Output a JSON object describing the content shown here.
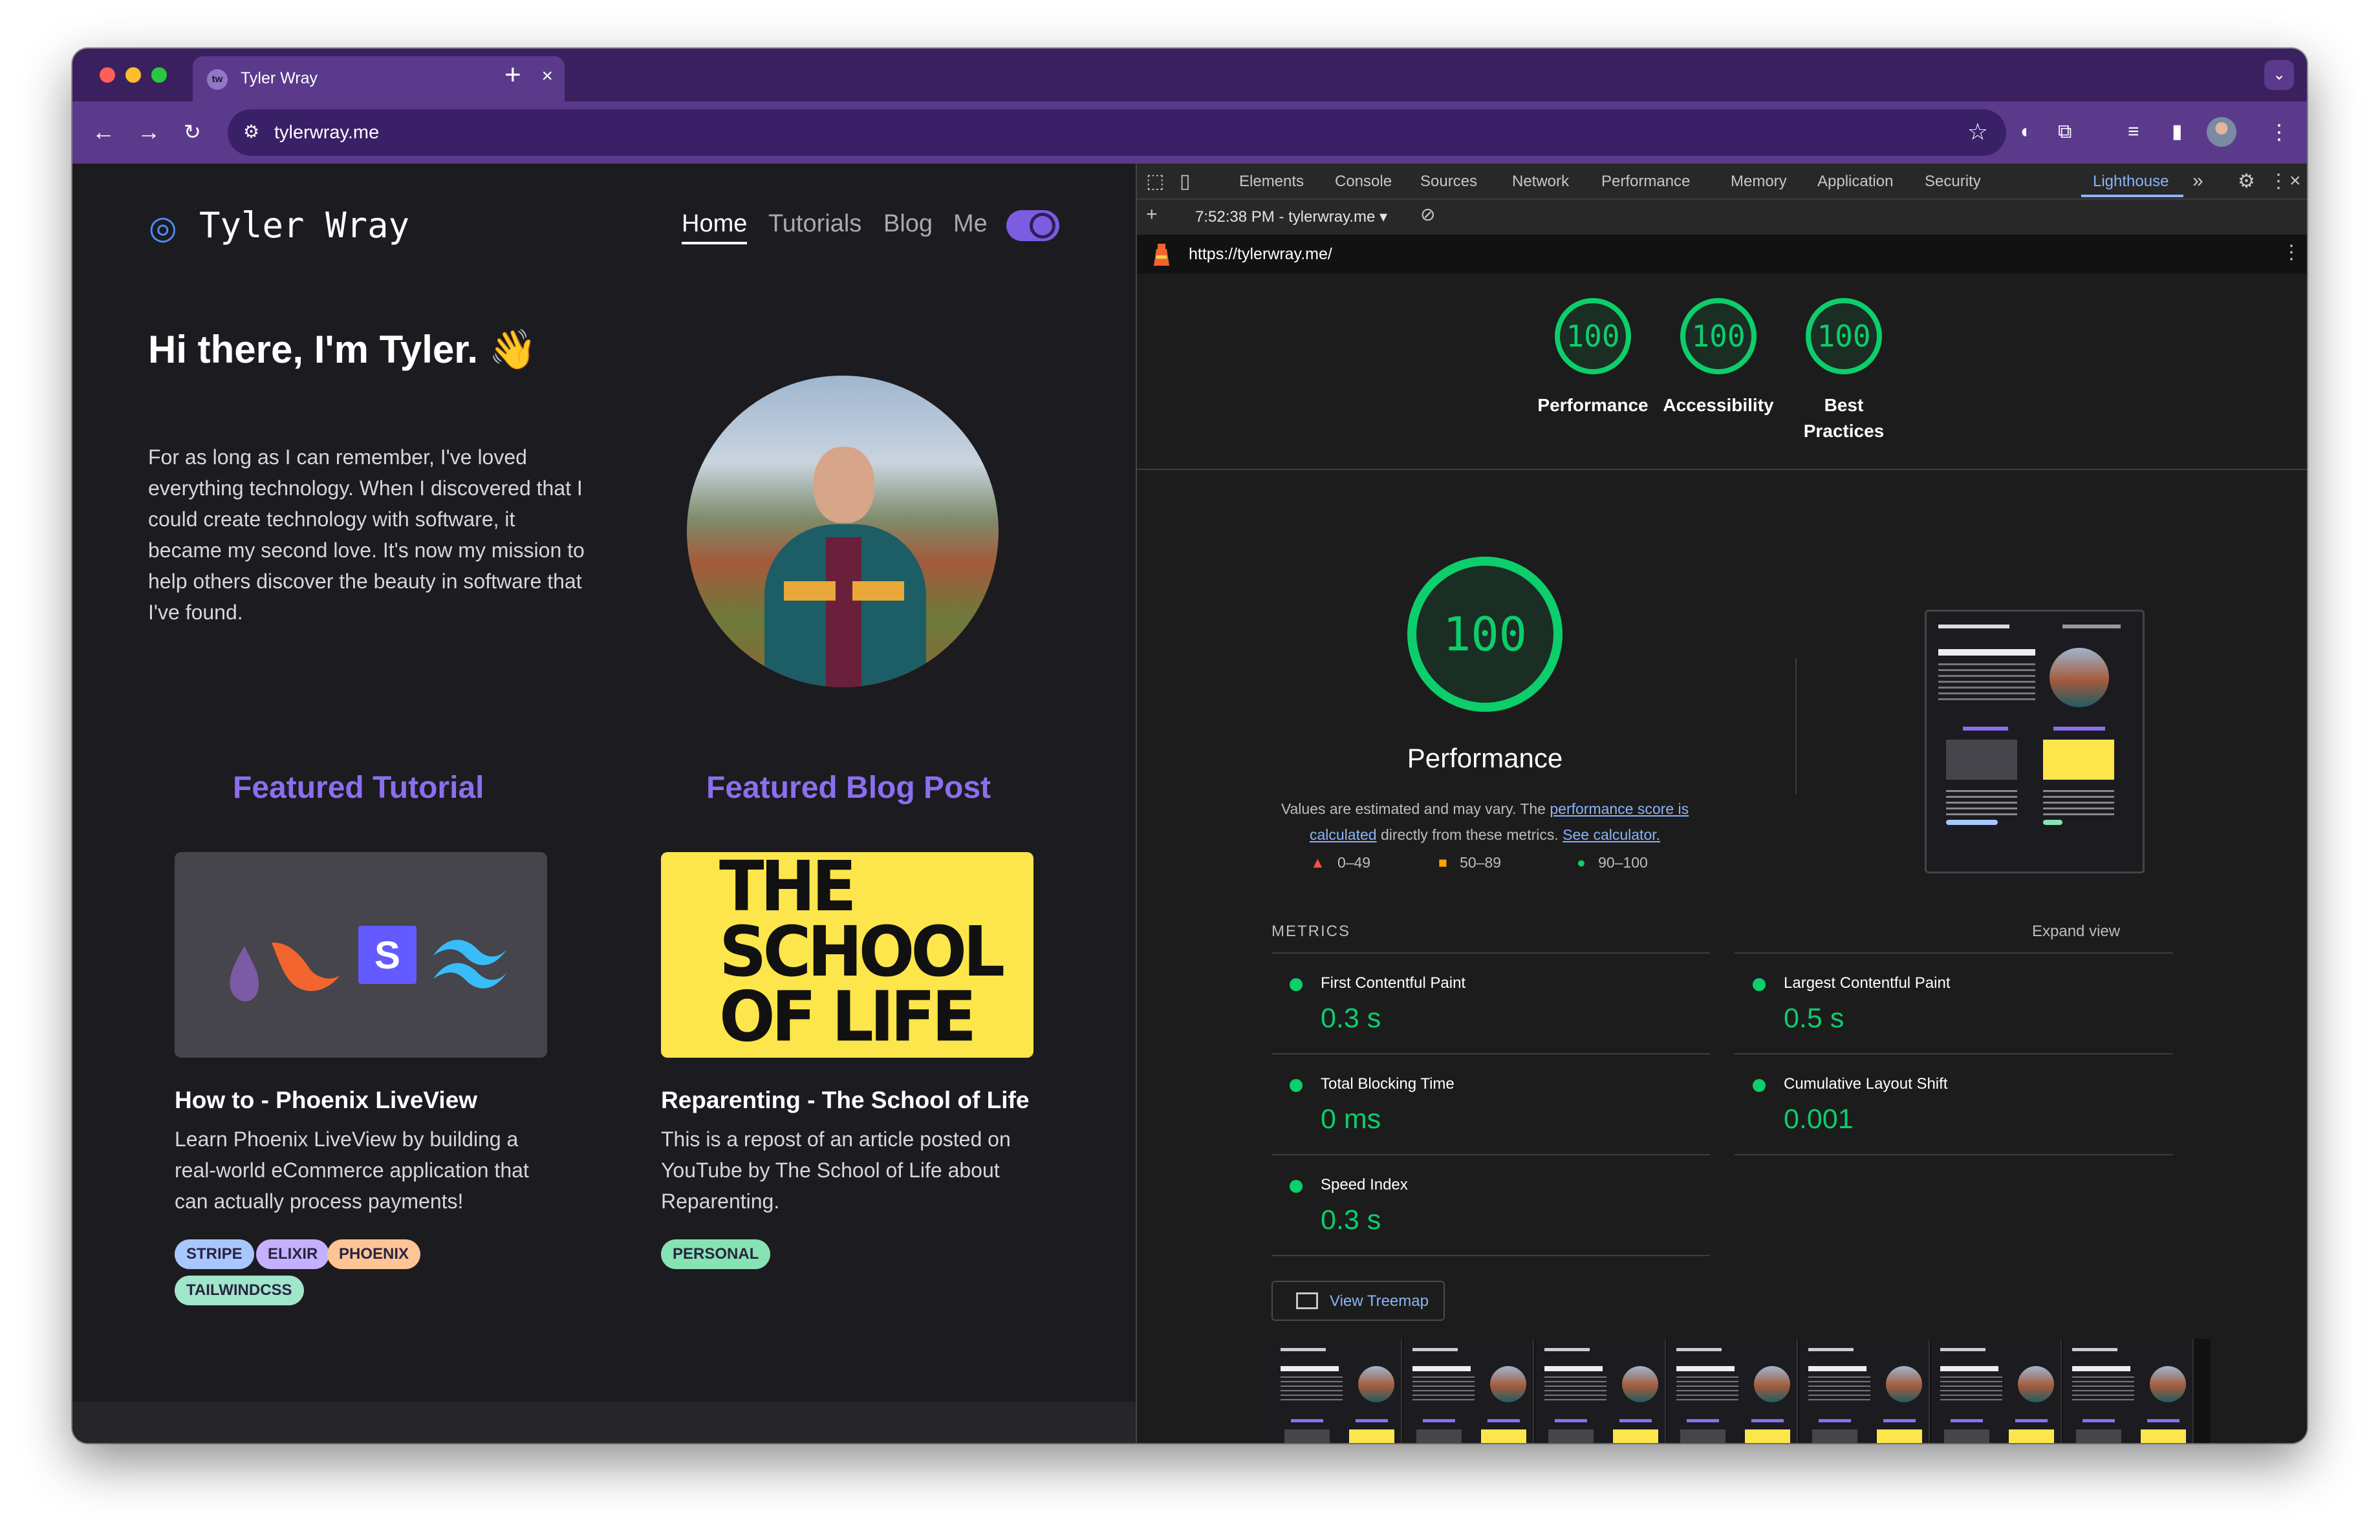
{
  "browser": {
    "tab_title": "Tyler Wray",
    "favicon_text": "tw",
    "url": "tylerwray.me",
    "traffic_lights": [
      "#ff5f57",
      "#febc2e",
      "#28c840"
    ],
    "theme_color": "#5b3a8c"
  },
  "site": {
    "brand": "Tyler Wray",
    "nav": [
      "Home",
      "Tutorials",
      "Blog",
      "Me"
    ],
    "hero": {
      "title": "Hi there, I'm Tyler. 👋",
      "body": "For as long as I can remember, I've loved everything technology. When I discovered that I could create technology with software, it became my second love. It's now my mission to help others discover the beauty in software that I've found."
    },
    "featured_tutorial": {
      "heading": "Featured Tutorial",
      "title": "How to - Phoenix LiveView",
      "description": "Learn Phoenix LiveView by building a real-world eCommerce application that can actually process payments!",
      "tags": [
        "STRIPE",
        "ELIXIR",
        "PHOENIX",
        "TAILWINDCSS"
      ]
    },
    "featured_blog": {
      "heading": "Featured Blog Post",
      "image_text": [
        "THE",
        "SCHOOL",
        "OF LIFE"
      ],
      "title": "Reparenting - The School of Life",
      "description": "This is a repost of an article posted on YouTube by The School of Life about Reparenting.",
      "tags": [
        "PERSONAL"
      ]
    },
    "accent_color": "#8b6ef0"
  },
  "devtools": {
    "tabs": [
      "Elements",
      "Console",
      "Sources",
      "Network",
      "Performance",
      "Memory",
      "Application",
      "Security",
      "Lighthouse"
    ],
    "active_tab": "Lighthouse",
    "report_time": "7:52:38 PM - tylerwray.me",
    "report_url": "https://tylerwray.me/",
    "scores": [
      {
        "label": "Performance",
        "value": "100"
      },
      {
        "label": "Accessibility",
        "value": "100"
      },
      {
        "label": "Best Practices",
        "value": "100"
      }
    ],
    "main_gauge": {
      "value": "100",
      "label": "Performance"
    },
    "note": {
      "prefix": "Values are estimated and may vary. The ",
      "link1": "performance score is calculated",
      "middle": " directly from these metrics. ",
      "link2": "See calculator."
    },
    "legend": [
      "0–49",
      "50–89",
      "90–100"
    ],
    "metrics_heading": "METRICS",
    "expand_label": "Expand view",
    "metrics": [
      {
        "name": "First Contentful Paint",
        "value": "0.3 s"
      },
      {
        "name": "Largest Contentful Paint",
        "value": "0.5 s"
      },
      {
        "name": "Total Blocking Time",
        "value": "0 ms"
      },
      {
        "name": "Cumulative Layout Shift",
        "value": "0.001"
      },
      {
        "name": "Speed Index",
        "value": "0.3 s"
      }
    ],
    "treemap_label": "View Treemap",
    "pass_color": "#0cce6b"
  }
}
